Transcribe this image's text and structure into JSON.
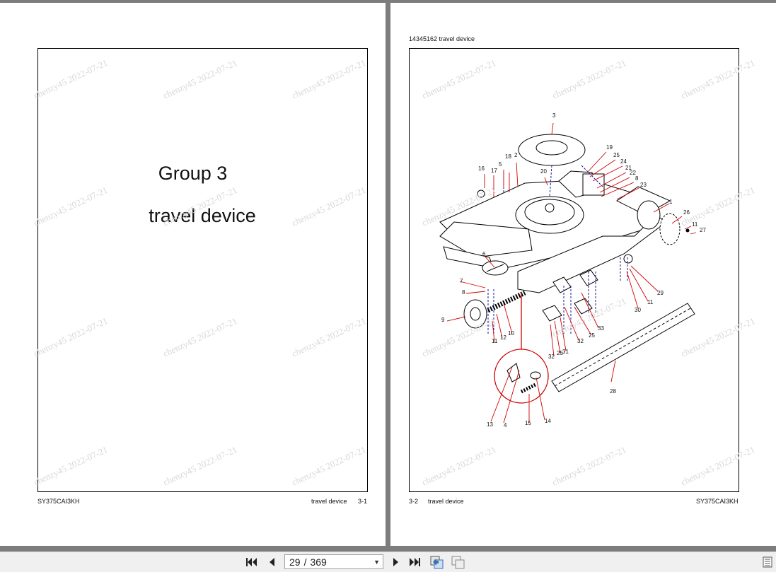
{
  "left_page": {
    "group_title": "Group 3",
    "section_title": "travel device",
    "footer_model": "SY375CAI3KH",
    "footer_section": "travel device",
    "footer_page": "3-1"
  },
  "right_page": {
    "header": "14345162   travel device",
    "footer_page": "3-2",
    "footer_section": "travel device",
    "footer_model": "SY375CAI3KH",
    "callouts": [
      "1",
      "2",
      "3",
      "4",
      "5",
      "6",
      "7",
      "8",
      "8",
      "9",
      "10",
      "11",
      "11",
      "11",
      "12",
      "13",
      "14",
      "15",
      "16",
      "17",
      "18",
      "19",
      "20",
      "21",
      "22",
      "23",
      "24",
      "25",
      "25",
      "25",
      "26",
      "27",
      "28",
      "29",
      "30",
      "31",
      "32",
      "32",
      "33"
    ]
  },
  "watermark": "chenzy45 2022-07-21",
  "toolbar": {
    "current_page": "29",
    "separator": "/",
    "total_pages": "369",
    "icons": [
      "first-page-icon",
      "previous-page-icon",
      "next-page-icon",
      "last-page-icon",
      "single-page-view-icon",
      "two-page-view-icon",
      "sidebar-toggle-icon"
    ]
  }
}
